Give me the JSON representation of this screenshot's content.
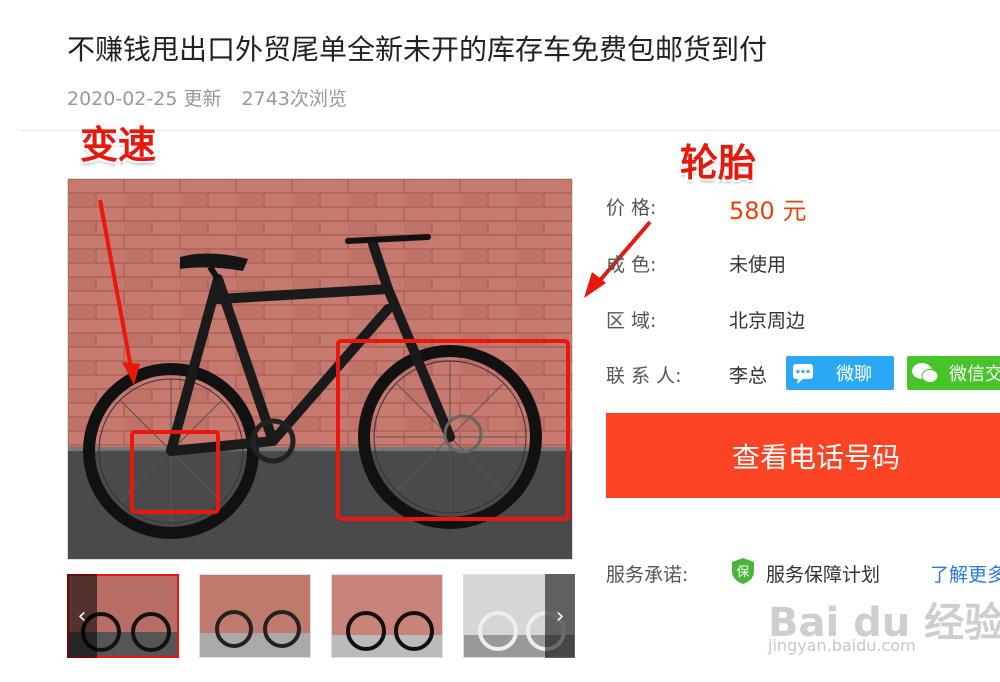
{
  "listing": {
    "title": "不赚钱甩出口外贸尾单全新未开的库存车免费包邮货到付",
    "date": "2020-02-25 更新",
    "views": "2743次浏览"
  },
  "annotations": {
    "shift": "变速",
    "tire": "轮胎"
  },
  "details": {
    "price_label": "价        格:",
    "price_value": "580 元",
    "condition_label": "成        色:",
    "condition_value": "未使用",
    "region_label": "区        域:",
    "region_value": "北京周边",
    "contact_label": "联  系  人:",
    "contact_value": "李总",
    "chat_button": "微聊",
    "wechat_button": "微信交"
  },
  "phone_button": "查看电话号码",
  "service": {
    "label": "服务承诺:",
    "shield_char": "保",
    "plan": "服务保障计划",
    "more": "了解更多"
  },
  "watermark": {
    "logo": "Bai du 经验",
    "url": "jingyan.baidu.com"
  },
  "colors": {
    "accent": "#fb4423",
    "price": "#e8430c",
    "chat": "#2aa8f3",
    "wechat": "#49c32a",
    "annotation": "#e8180c"
  }
}
